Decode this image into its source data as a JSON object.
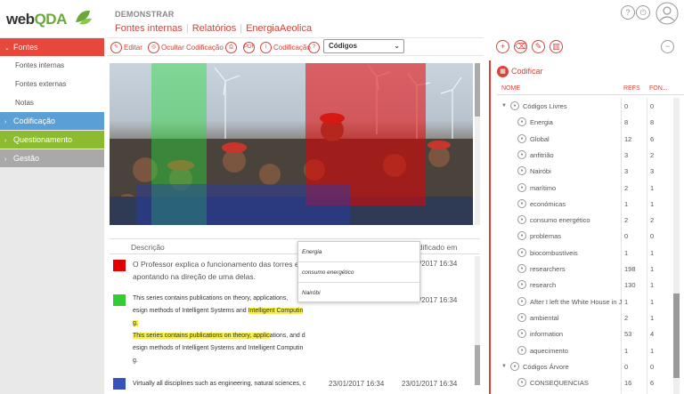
{
  "app": {
    "logo_main": "web",
    "logo_accent": "QDA"
  },
  "project": {
    "title": "DEMONSTRAR"
  },
  "breadcrumb": [
    "Fontes internas",
    "Relatórios",
    "EnergiaAeolica"
  ],
  "header_icons": [
    "help-icon",
    "power-icon",
    "user-avatar-icon"
  ],
  "sidebar": {
    "fontes": {
      "label": "Fontes",
      "color": "#e8473c"
    },
    "fontes_items": [
      "Fontes internas",
      "Fontes externas",
      "Notas"
    ],
    "codificacao": {
      "label": "Codificação",
      "color": "#5a9fd6"
    },
    "questionamento": {
      "label": "Questionamento",
      "color": "#8cbb2f"
    },
    "gestao": {
      "label": "Gestão",
      "color": "#a9a9a9"
    }
  },
  "toolbar": {
    "editar": "Editar",
    "ocultar": "Ocultar Codificação",
    "pdf_icon": "PDF",
    "codificacao": "Codificação",
    "codes_select": "Códigos"
  },
  "table": {
    "col_desc": "Descrição",
    "col_date": "Modificado em",
    "rows": [
      {
        "color": "#e00000",
        "text1": "O Professor explica o funcionamento das torres e",
        "text2": "apontando na direção de uma delas.",
        "date": "23/01/2017 16:34"
      },
      {
        "color": "#33cc33",
        "line1": "This series contains publications on theory, applications, ",
        "line2a": "esign methods of Intelligent Systems and ",
        "line2b": "Intelligent Computin",
        "line3": "g.",
        "line4a": "This series contains publications on theory, applic",
        "line4b": "ations, and d",
        "line5": "esign methods of Intelligent Systems and Intelligent Computin",
        "line6": "g.",
        "date_partial": "23/01/2017 16:34",
        "date": "23/01/2017 16:34"
      },
      {
        "color": "#3355bb",
        "text": "Virtually all disciplines such as engineering, natural sciences, c",
        "date1": "23/01/2017 16:34",
        "date2": "23/01/2017 16:34"
      }
    ]
  },
  "popup": {
    "items": [
      "Energia",
      "consumo energético",
      "Nairóbi"
    ]
  },
  "right_panel": {
    "codificar": "Codificar",
    "col_name": "NOME",
    "col_refs": "REFS",
    "col_fon": "FON...",
    "codes": [
      {
        "name": "Códigos Livres",
        "refs": "0",
        "fon": "0",
        "level": 0
      },
      {
        "name": "Energia",
        "refs": "8",
        "fon": "8",
        "level": 1
      },
      {
        "name": "Global",
        "refs": "12",
        "fon": "6",
        "level": 1
      },
      {
        "name": "anfitrião",
        "refs": "3",
        "fon": "2",
        "level": 1
      },
      {
        "name": "Nairóbi",
        "refs": "3",
        "fon": "3",
        "level": 1
      },
      {
        "name": "marítimo",
        "refs": "2",
        "fon": "1",
        "level": 1
      },
      {
        "name": "económicas",
        "refs": "1",
        "fon": "1",
        "level": 1
      },
      {
        "name": "consumo energético",
        "refs": "2",
        "fon": "2",
        "level": 1
      },
      {
        "name": "problemas",
        "refs": "0",
        "fon": "0",
        "level": 1
      },
      {
        "name": "biocombustíveis",
        "refs": "1",
        "fon": "1",
        "level": 1
      },
      {
        "name": "researchers",
        "refs": "198",
        "fon": "1",
        "level": 1
      },
      {
        "name": "research",
        "refs": "130",
        "fon": "1",
        "level": 1
      },
      {
        "name": "After I left the White House in J",
        "refs": "1",
        "fon": "1",
        "level": 1
      },
      {
        "name": "ambiental",
        "refs": "2",
        "fon": "1",
        "level": 1
      },
      {
        "name": "information",
        "refs": "53",
        "fon": "4",
        "level": 1
      },
      {
        "name": "aquecimento",
        "refs": "1",
        "fon": "1",
        "level": 1
      },
      {
        "name": "Códigos Árvore",
        "refs": "0",
        "fon": "0",
        "level": 0
      },
      {
        "name": "CONSEQUENCIAS",
        "refs": "16",
        "fon": "6",
        "level": 1
      }
    ]
  }
}
